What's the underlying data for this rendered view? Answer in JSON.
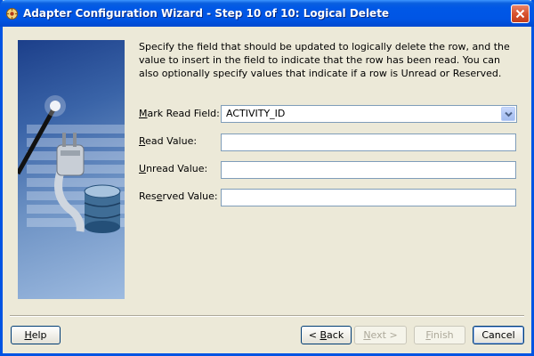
{
  "window": {
    "title": "Adapter Configuration Wizard - Step 10 of 10: Logical Delete"
  },
  "description": "Specify the field that should be updated to logically delete the row, and the value to insert in the field to indicate that the row has been read.  You can also optionally specify values that indicate if a row is Unread or Reserved.",
  "form": {
    "mark_read_field": {
      "label_pre": "",
      "label_ul": "M",
      "label_post": "ark Read Field:",
      "value": "ACTIVITY_ID"
    },
    "read_value": {
      "label_pre": "",
      "label_ul": "R",
      "label_post": "ead Value:",
      "value": ""
    },
    "unread_value": {
      "label_pre": "",
      "label_ul": "U",
      "label_post": "nread Value:",
      "value": ""
    },
    "reserved_value": {
      "label_pre": "Res",
      "label_ul": "e",
      "label_post": "rved Value:",
      "value": ""
    }
  },
  "buttons": {
    "help": {
      "pre": "",
      "ul": "H",
      "post": "elp"
    },
    "back": {
      "pre": "< ",
      "ul": "B",
      "post": "ack"
    },
    "next": {
      "pre": "",
      "ul": "N",
      "post": "ext >"
    },
    "finish": {
      "pre": "",
      "ul": "F",
      "post": "inish"
    },
    "cancel": {
      "pre": "Cancel",
      "ul": "",
      "post": ""
    }
  },
  "colors": {
    "titlebar": "#0055e5",
    "dialog_bg": "#ece9d8",
    "close_button": "#d8532f",
    "field_border": "#7f9db9"
  },
  "icons": {
    "title": "wizard-icon",
    "close": "close-icon",
    "dropdown": "chevron-down-icon",
    "art": "plug-database-illustration"
  }
}
